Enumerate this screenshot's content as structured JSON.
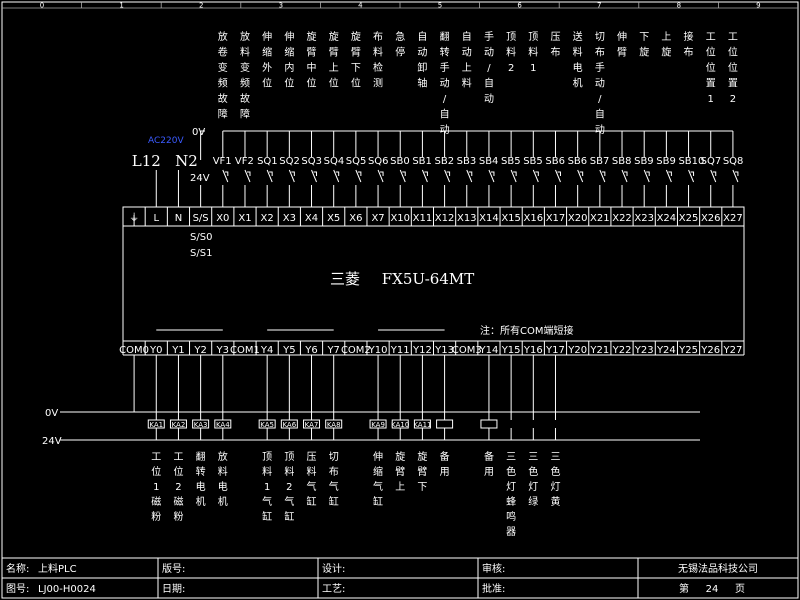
{
  "grid_numbers": [
    "0",
    "1",
    "2",
    "3",
    "4",
    "5",
    "6",
    "7",
    "8",
    "9"
  ],
  "power": {
    "l_label": "L12",
    "n_label": "N2",
    "ac_label": "AC220V",
    "ov_top": "0V",
    "v24_label": "24V"
  },
  "plc_model": {
    "brand": "三菱",
    "model": "FX5U-64MT"
  },
  "com_note": "注：所有COM端短接",
  "input_descriptions": [
    "放卷变频故障",
    "放料变频故障",
    "伸缩外位",
    "伸缩内位",
    "旋臂中位",
    "旋臂上位",
    "旋臂下位",
    "布料检测",
    "急停",
    "自动卸轴",
    "翻转手动/自动",
    "自动上料",
    "手动/自动",
    "顶料2",
    "顶料1",
    "压布",
    "送料电机",
    "切布手动/自动",
    "伸臂",
    "下旋",
    "上旋",
    "接布",
    "工位位置1",
    "工位位置2"
  ],
  "input_devices": [
    "VF1",
    "VF2",
    "SQ1",
    "SQ2",
    "SQ3",
    "SQ4",
    "SQ5",
    "SQ6",
    "SB0",
    "SB1",
    "SB2",
    "SB3",
    "SB4",
    "SB5",
    "SB5",
    "SB6",
    "SB6",
    "SB7",
    "SB8",
    "SB9",
    "SB9",
    "SB10",
    "SQ7",
    "SQ8"
  ],
  "input_terminals": [
    "⏚",
    "L",
    "N",
    "S/S",
    "X0",
    "X1",
    "X2",
    "X3",
    "X4",
    "X5",
    "X6",
    "X7",
    "X10",
    "X11",
    "X12",
    "X13",
    "X14",
    "X15",
    "X16",
    "X17",
    "X20",
    "X21",
    "X22",
    "X23",
    "X24",
    "X25",
    "X26",
    "X27"
  ],
  "ss_labels": [
    "S/S0",
    "S/S1"
  ],
  "output_terminals": [
    "COM0",
    "Y0",
    "Y1",
    "Y2",
    "Y3",
    "COM1",
    "Y4",
    "Y5",
    "Y6",
    "Y7",
    "COM2",
    "Y10",
    "Y11",
    "Y12",
    "Y13",
    "COM3",
    "Y14",
    "Y15",
    "Y16",
    "Y17",
    "Y20",
    "Y21",
    "Y22",
    "Y23",
    "Y24",
    "Y25",
    "Y26",
    "Y27"
  ],
  "relay_labels": [
    "KA1",
    "KA2",
    "KA3",
    "KA4",
    "KA5",
    "KA6",
    "KA7",
    "KA8",
    "KA9",
    "KA10",
    "KA11"
  ],
  "bus_labels": {
    "ov": "0V",
    "v24": "24V"
  },
  "output_descriptions": [
    "工位1磁粉",
    "工位2磁粉",
    "翻转电机",
    "放料电机",
    "顶料1气缸",
    "顶料2气缸",
    "压料气缸",
    "切布气缸",
    "伸缩气缸",
    "旋臂上",
    "旋臂下",
    "备用",
    "备用",
    "三色灯蜂鸣器",
    "三色灯绿",
    "三色灯黄"
  ],
  "title_block": {
    "name_label": "名称:",
    "name_value": "上料PLC",
    "version_label": "版号:",
    "design_label": "设计:",
    "review_label": "审核:",
    "company": "无锡法品科技公司",
    "drawing_label": "图号:",
    "drawing_value": "LJ00-H0024",
    "date_label": "日期:",
    "process_label": "工艺:",
    "approve_label": "批准:",
    "page_prefix": "第",
    "page_number": "24",
    "page_suffix": "页"
  }
}
